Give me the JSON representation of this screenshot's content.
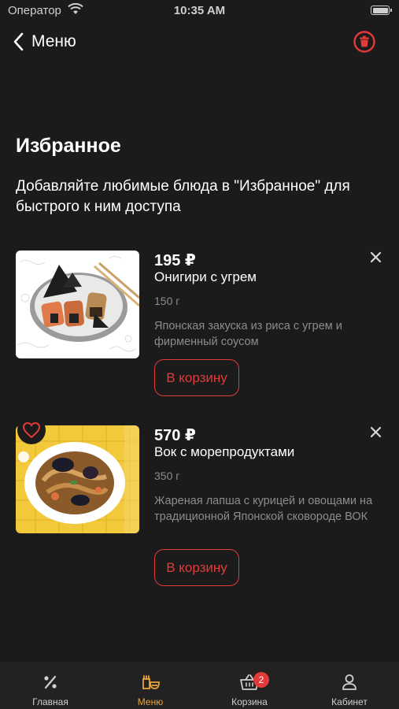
{
  "status_bar": {
    "carrier": "Оператор",
    "time": "10:35 AM"
  },
  "nav": {
    "back_label": "Меню"
  },
  "header": {
    "title": "Избранное",
    "subtitle": "Добавляйте любимые блюда в \"Избранное\" для быстрого к ним доступа"
  },
  "items": [
    {
      "price": "195 ₽",
      "name": "Онигири с угрем",
      "weight": "150 г",
      "description": "Японская закуска из риса с угрем и фирменный соусом",
      "cart_label": "В корзину"
    },
    {
      "price": "570 ₽",
      "name": "Вок с морепродуктами",
      "weight": "350 г",
      "description": "Жареная лапша с курицей и овощами на традиционной Японской сковороде ВОК",
      "cart_label": "В корзину"
    }
  ],
  "tabs": [
    {
      "label": "Главная",
      "icon": "percent-icon",
      "active": false
    },
    {
      "label": "Меню",
      "icon": "menu-food-icon",
      "active": true
    },
    {
      "label": "Корзина",
      "icon": "basket-icon",
      "active": false,
      "badge": "2"
    },
    {
      "label": "Кабинет",
      "icon": "user-icon",
      "active": false
    }
  ],
  "colors": {
    "background": "#1c1b1b",
    "accent_red": "#e23a3a",
    "active_tab": "#e9a43a",
    "muted_text": "#8c8c8c"
  }
}
